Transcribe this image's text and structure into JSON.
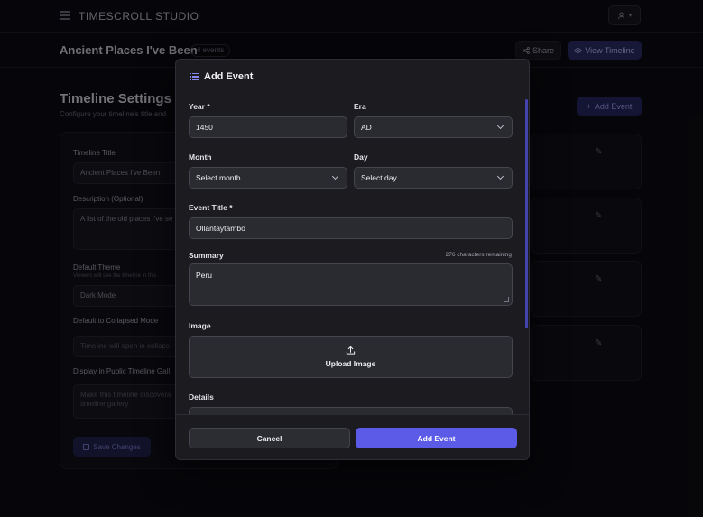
{
  "app": {
    "brand": "TIMESCROLL STUDIO",
    "user_icon": "user-icon"
  },
  "timeline": {
    "title": "Ancient Places I've Been",
    "events_badge": "4 events",
    "share_label": "Share",
    "view_label": "View Timeline"
  },
  "settings": {
    "heading": "Timeline Settings",
    "subheading": "Configure your timeline's title and",
    "title_label": "Timeline Title",
    "title_value": "Ancient Places I've Been",
    "description_label": "Description (Optional)",
    "description_value": "A list of the old places I've se",
    "theme_label": "Default Theme",
    "theme_hint": "Viewers will see the timeline in this",
    "theme_value": "Dark Mode",
    "collapsed_label": "Default to Collapsed Mode",
    "collapsed_value": "Timeline will open in collaps",
    "gallery_label": "Display in Public Timeline Gall",
    "gallery_value_line1": "Make this timeline discovera",
    "gallery_value_line2": "timeline gallery",
    "save_label": "Save Changes"
  },
  "events_panel": {
    "add_label": "Add Event"
  },
  "modal": {
    "title": "Add Event",
    "year_label": "Year *",
    "year_value": "1450",
    "era_label": "Era",
    "era_value": "AD",
    "month_label": "Month",
    "month_value": "Select month",
    "day_label": "Day",
    "day_value": "Select day",
    "event_title_label": "Event Title *",
    "event_title_value": "Ollantaytambo",
    "summary_label": "Summary",
    "summary_remaining": "276 characters remaining",
    "summary_value": "Peru",
    "image_label": "Image",
    "upload_label": "Upload Image",
    "details_label": "Details",
    "cancel_label": "Cancel",
    "submit_label": "Add Event"
  },
  "colors": {
    "accent": "#5b5be8",
    "background": "#0c0c13",
    "modal": "#1b1b20"
  }
}
